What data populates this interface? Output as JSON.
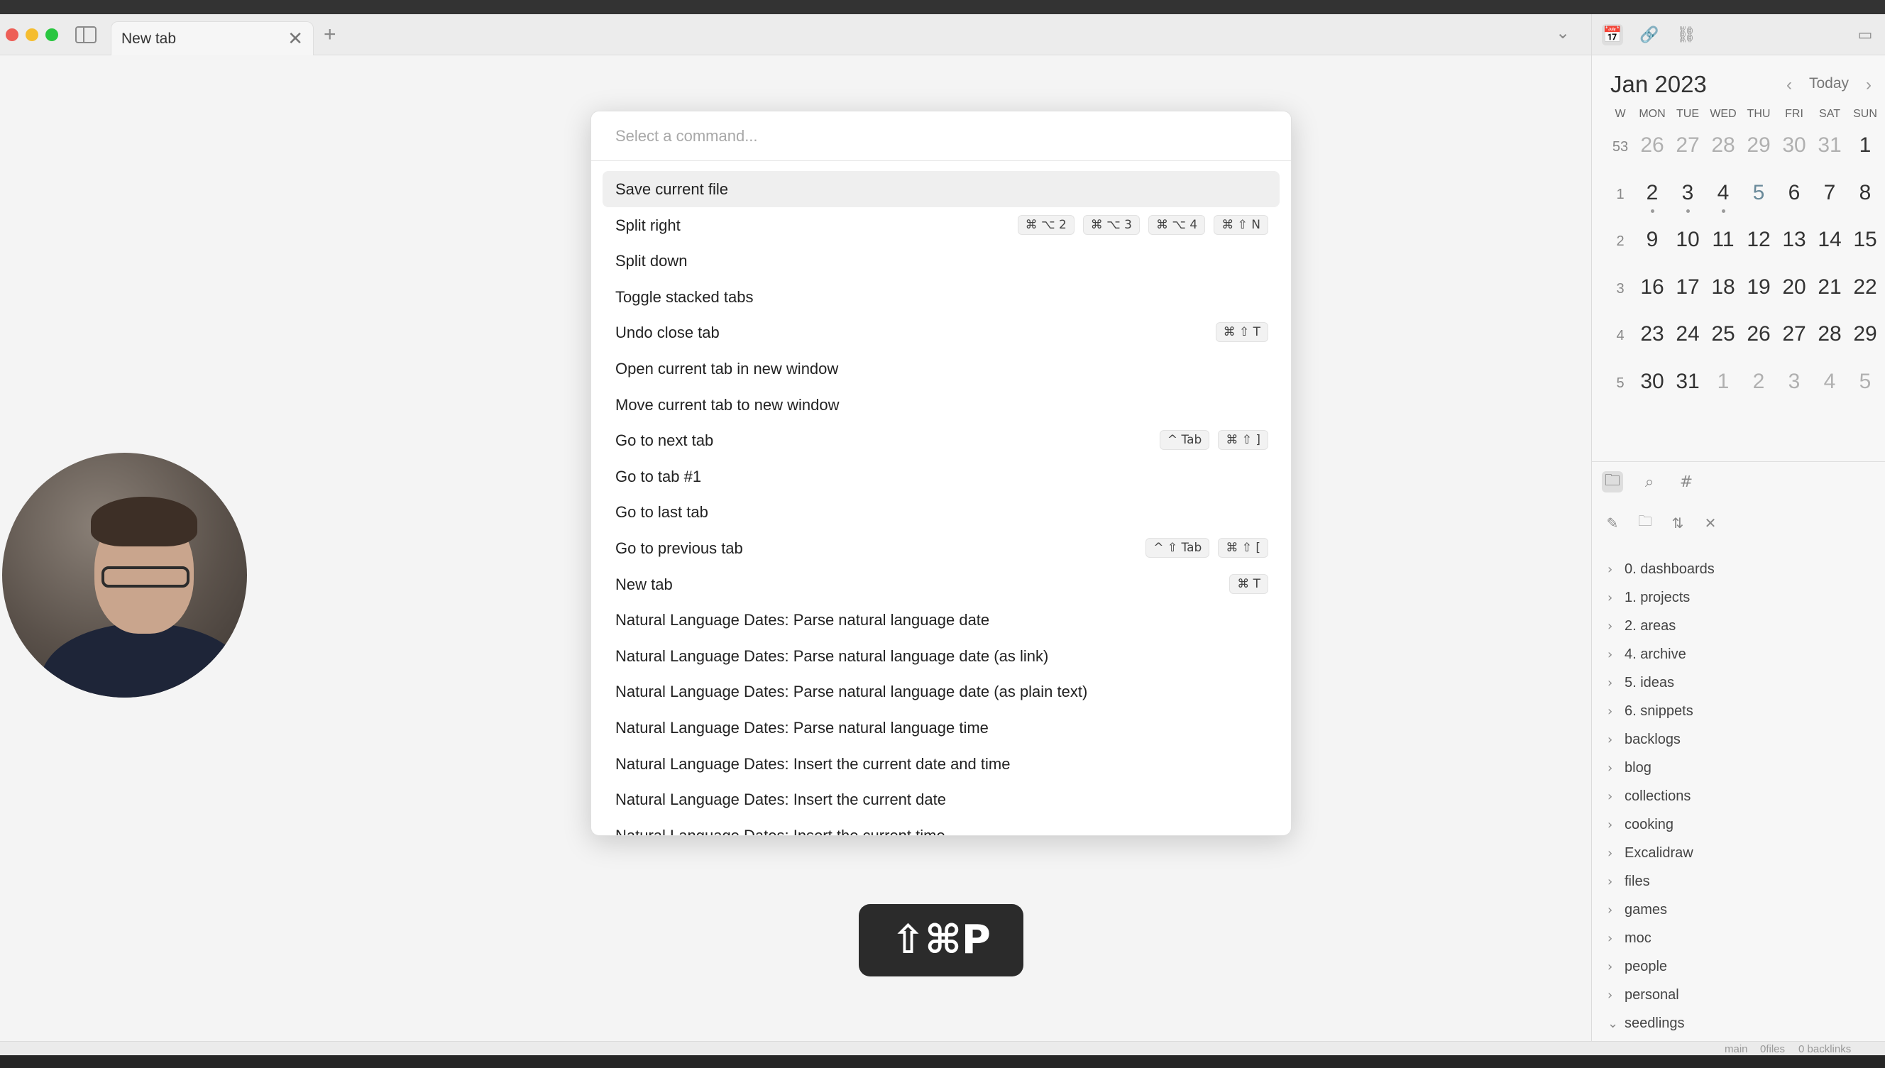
{
  "tabbar": {
    "tab_title": "New tab",
    "close_glyph": "✕",
    "new_tab_glyph": "+",
    "chevron_glyph": "⌄"
  },
  "palette": {
    "placeholder": "Select a command...",
    "selected_index": 0,
    "commands": [
      {
        "label": "Save current file",
        "hotkeys": []
      },
      {
        "label": "Split right",
        "hotkeys": [
          "⌘ ⌥ 2",
          "⌘ ⌥ 3",
          "⌘ ⌥ 4",
          "⌘ ⇧ N"
        ]
      },
      {
        "label": "Split down",
        "hotkeys": []
      },
      {
        "label": "Toggle stacked tabs",
        "hotkeys": []
      },
      {
        "label": "Undo close tab",
        "hotkeys": [
          "⌘ ⇧ T"
        ]
      },
      {
        "label": "Open current tab in new window",
        "hotkeys": []
      },
      {
        "label": "Move current tab to new window",
        "hotkeys": []
      },
      {
        "label": "Go to next tab",
        "hotkeys": [
          "^ Tab",
          "⌘ ⇧ ]"
        ]
      },
      {
        "label": "Go to tab #1",
        "hotkeys": []
      },
      {
        "label": "Go to last tab",
        "hotkeys": []
      },
      {
        "label": "Go to previous tab",
        "hotkeys": [
          "^ ⇧ Tab",
          "⌘ ⇧ ["
        ]
      },
      {
        "label": "New tab",
        "hotkeys": [
          "⌘ T"
        ]
      },
      {
        "label": "Natural Language Dates: Parse natural language date",
        "hotkeys": []
      },
      {
        "label": "Natural Language Dates: Parse natural language date (as link)",
        "hotkeys": []
      },
      {
        "label": "Natural Language Dates: Parse natural language date (as plain text)",
        "hotkeys": []
      },
      {
        "label": "Natural Language Dates: Parse natural language time",
        "hotkeys": []
      },
      {
        "label": "Natural Language Dates: Insert the current date and time",
        "hotkeys": []
      },
      {
        "label": "Natural Language Dates: Insert the current date",
        "hotkeys": []
      },
      {
        "label": "Natural Language Dates: Insert the current time",
        "hotkeys": []
      }
    ]
  },
  "keyboard_overlay": "⇧⌘P",
  "calendar": {
    "title": "Jan 2023",
    "today_label": "Today",
    "prev_glyph": "‹",
    "next_glyph": "›",
    "headers": [
      "W",
      "MON",
      "TUE",
      "WED",
      "THU",
      "FRI",
      "SAT",
      "SUN"
    ],
    "weeks": [
      {
        "wk": "53",
        "days": [
          {
            "d": "26",
            "dim": true
          },
          {
            "d": "27",
            "dim": true
          },
          {
            "d": "28",
            "dim": true
          },
          {
            "d": "29",
            "dim": true
          },
          {
            "d": "30",
            "dim": true
          },
          {
            "d": "31",
            "dim": true
          },
          {
            "d": "1"
          }
        ]
      },
      {
        "wk": "1",
        "days": [
          {
            "d": "2",
            "dot": true
          },
          {
            "d": "3",
            "dot": true
          },
          {
            "d": "4",
            "dot": true
          },
          {
            "d": "5",
            "today": true
          },
          {
            "d": "6"
          },
          {
            "d": "7"
          },
          {
            "d": "8"
          }
        ]
      },
      {
        "wk": "2",
        "days": [
          {
            "d": "9"
          },
          {
            "d": "10"
          },
          {
            "d": "11"
          },
          {
            "d": "12"
          },
          {
            "d": "13"
          },
          {
            "d": "14"
          },
          {
            "d": "15"
          }
        ]
      },
      {
        "wk": "3",
        "days": [
          {
            "d": "16"
          },
          {
            "d": "17"
          },
          {
            "d": "18"
          },
          {
            "d": "19"
          },
          {
            "d": "20"
          },
          {
            "d": "21"
          },
          {
            "d": "22"
          }
        ]
      },
      {
        "wk": "4",
        "days": [
          {
            "d": "23"
          },
          {
            "d": "24"
          },
          {
            "d": "25"
          },
          {
            "d": "26"
          },
          {
            "d": "27"
          },
          {
            "d": "28"
          },
          {
            "d": "29"
          }
        ]
      },
      {
        "wk": "5",
        "days": [
          {
            "d": "30"
          },
          {
            "d": "31"
          },
          {
            "d": "1",
            "dim": true
          },
          {
            "d": "2",
            "dim": true
          },
          {
            "d": "3",
            "dim": true
          },
          {
            "d": "4",
            "dim": true
          },
          {
            "d": "5",
            "dim": true
          }
        ]
      }
    ]
  },
  "file_tree": [
    {
      "name": "0. dashboards",
      "expanded": false
    },
    {
      "name": "1. projects",
      "expanded": false
    },
    {
      "name": "2. areas",
      "expanded": false
    },
    {
      "name": "4. archive",
      "expanded": false
    },
    {
      "name": "5. ideas",
      "expanded": false
    },
    {
      "name": "6. snippets",
      "expanded": false
    },
    {
      "name": "backlogs",
      "expanded": false
    },
    {
      "name": "blog",
      "expanded": false
    },
    {
      "name": "collections",
      "expanded": false
    },
    {
      "name": "cooking",
      "expanded": false
    },
    {
      "name": "Excalidraw",
      "expanded": false
    },
    {
      "name": "files",
      "expanded": false
    },
    {
      "name": "games",
      "expanded": false
    },
    {
      "name": "moc",
      "expanded": false
    },
    {
      "name": "people",
      "expanded": false
    },
    {
      "name": "personal",
      "expanded": false
    },
    {
      "name": "seedlings",
      "expanded": true
    }
  ],
  "statusbar": {
    "branch": "main",
    "files": "0files",
    "backlinks": "0 backlinks"
  },
  "icons": {
    "calendar": "📅",
    "link": "🔗",
    "unlink": "⛓",
    "panel": "▭",
    "folder": "🗀",
    "search": "⌕",
    "tag": "#",
    "new_note": "✎",
    "new_folder": "🗀",
    "sort": "⇅",
    "collapse": "✕"
  }
}
